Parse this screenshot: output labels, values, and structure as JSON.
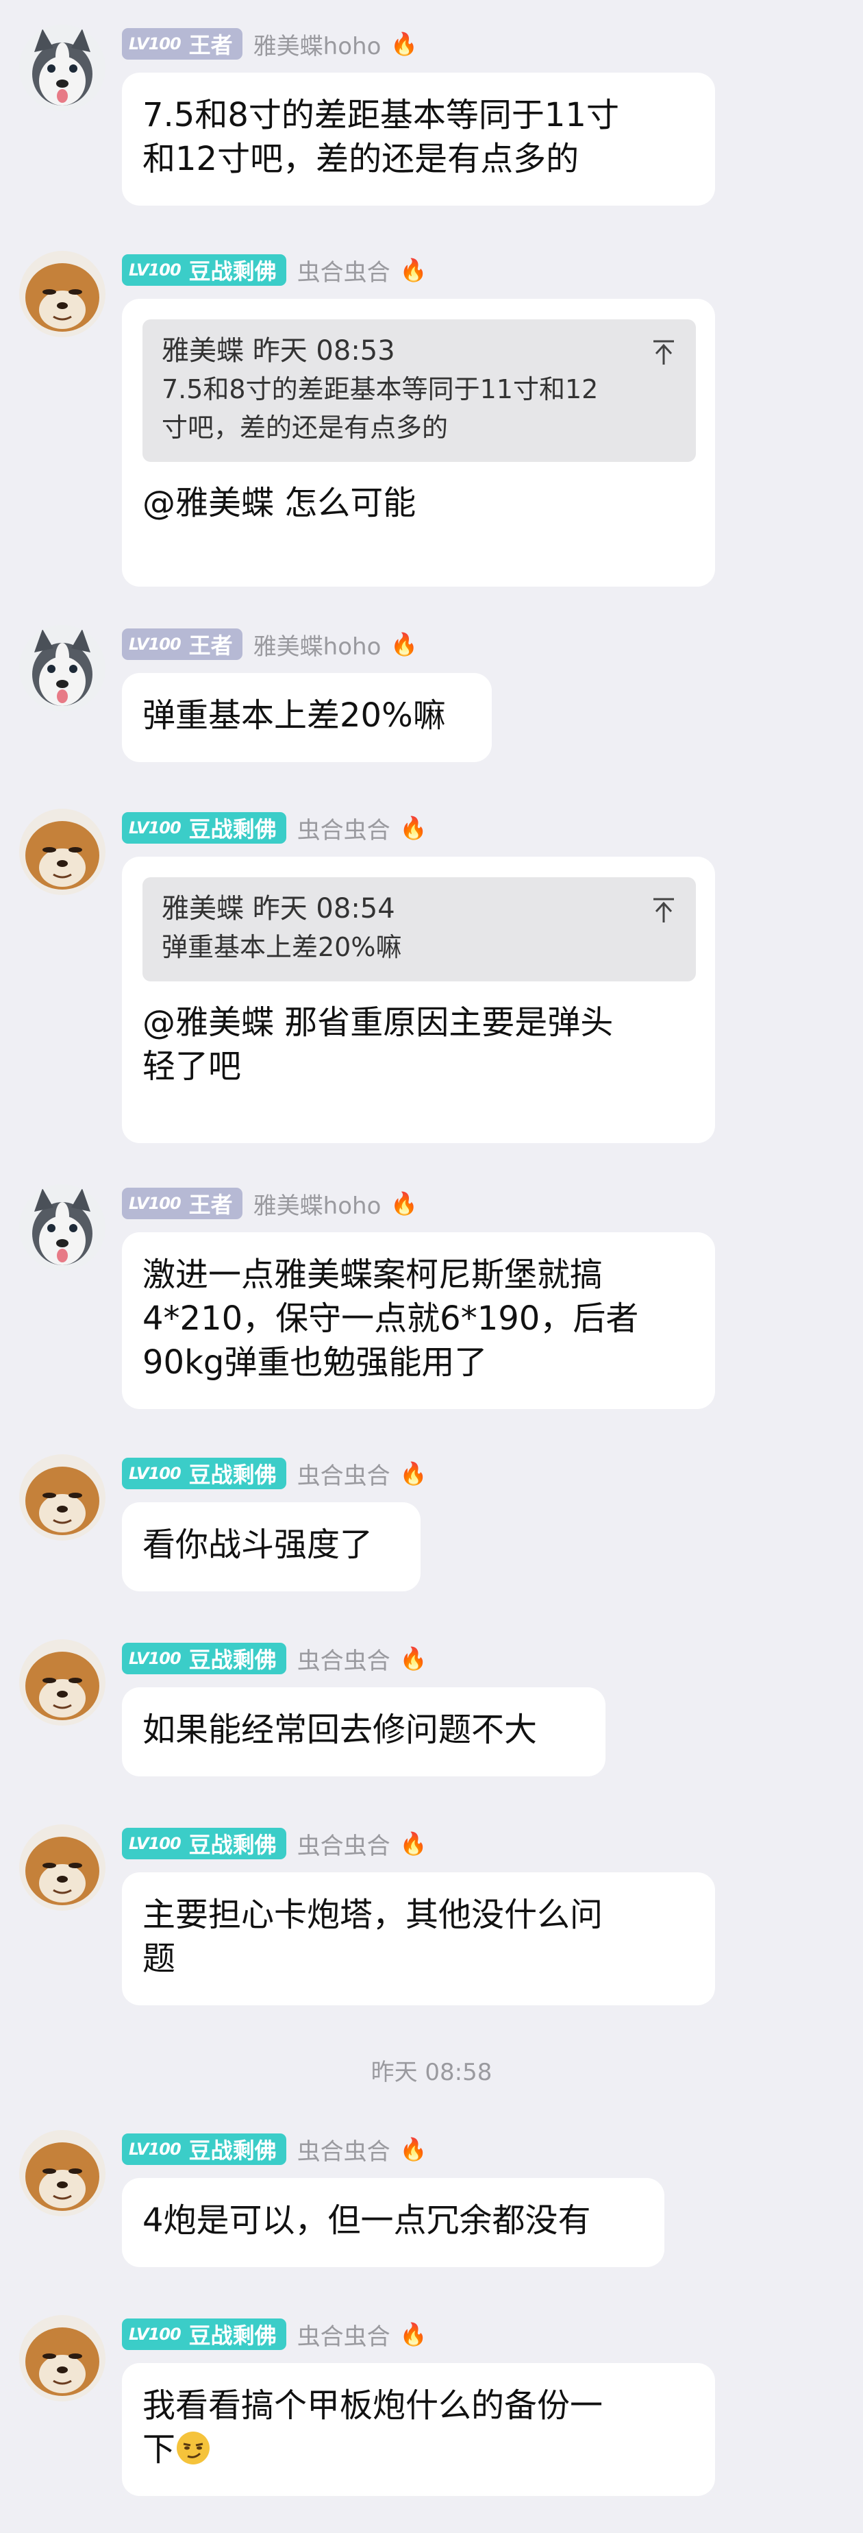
{
  "users": {
    "king": {
      "level": "LV100",
      "rank": "王者",
      "name": "雅美蝶hoho",
      "flame": "🔥"
    },
    "buddha": {
      "level": "LV100",
      "rank": "豆战剩佛",
      "name": "虫合虫合",
      "flame": "🔥"
    }
  },
  "messages": [
    {
      "lines": [
        "7.5和8寸的差距基本等同于11寸",
        "和12寸吧，差的还是有点多的"
      ]
    },
    {
      "quote": {
        "author": "雅美蝶",
        "time": "昨天 08:53",
        "lines": [
          "7.5和8寸的差距基本等同于11寸和12",
          "寸吧，差的还是有点多的"
        ]
      },
      "lines": [
        "@雅美蝶 怎么可能"
      ]
    },
    {
      "lines": [
        "弹重基本上差20%嘛"
      ]
    },
    {
      "quote": {
        "author": "雅美蝶",
        "time": "昨天 08:54",
        "lines": [
          "弹重基本上差20%嘛"
        ]
      },
      "lines": [
        "@雅美蝶 那省重原因主要是弹头",
        "轻了吧"
      ]
    },
    {
      "lines": [
        "激进一点雅美蝶案柯尼斯堡就搞",
        "4*210，保守一点就6*190，后者",
        "90kg弹重也勉强能用了"
      ]
    },
    {
      "lines": [
        "看你战斗强度了"
      ]
    },
    {
      "lines": [
        "如果能经常回去修问题不大"
      ]
    },
    {
      "lines": [
        "主要担心卡炮塔，其他没什么问",
        "题"
      ]
    },
    {
      "lines": [
        "4炮是可以，但一点冗余都没有"
      ]
    },
    {
      "lines": [
        "我看看搞个甲板炮什么的备份一",
        "下"
      ]
    }
  ],
  "time_divider": "昨天 08:58",
  "colors": {
    "background": "#efeff4",
    "bubble": "#ffffff",
    "badge_king": "#b6b9d4",
    "badge_buddha": "#3bcdc8"
  }
}
